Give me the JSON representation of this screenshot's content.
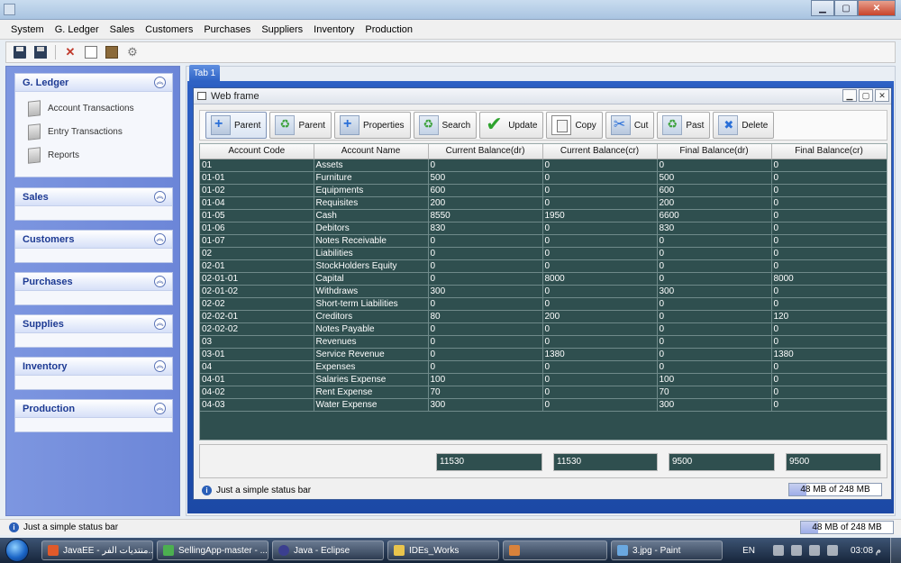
{
  "menu": [
    "System",
    "G. Ledger",
    "Sales",
    "Customers",
    "Purchases",
    "Suppliers",
    "Inventory",
    "Production"
  ],
  "sidebar": {
    "groups": [
      {
        "title": "G. Ledger",
        "items": [
          "Account Transactions",
          "Entry Transactions",
          "Reports"
        ]
      },
      {
        "title": "Sales",
        "items": []
      },
      {
        "title": "Customers",
        "items": []
      },
      {
        "title": "Purchases",
        "items": []
      },
      {
        "title": "Supplies",
        "items": []
      },
      {
        "title": "Inventory",
        "items": []
      },
      {
        "title": "Production",
        "items": []
      }
    ]
  },
  "tab": {
    "label": "Tab 1"
  },
  "frame": {
    "title": "Web frame"
  },
  "actions": [
    "Parent",
    "Parent",
    "Properties",
    "Search",
    "Update",
    "Copy",
    "Cut",
    "Past",
    "Delete"
  ],
  "table": {
    "headers": [
      "Account Code",
      "Account Name",
      "Current Balance(dr)",
      "Current Balance(cr)",
      "Final Balance(dr)",
      "Final Balance(cr)"
    ],
    "rows": [
      [
        "01",
        "Assets",
        "0",
        "0",
        "0",
        "0"
      ],
      [
        "01-01",
        "Furniture",
        "500",
        "0",
        "500",
        "0"
      ],
      [
        "01-02",
        "Equipments",
        "600",
        "0",
        "600",
        "0"
      ],
      [
        "01-04",
        "Requisites",
        "200",
        "0",
        "200",
        "0"
      ],
      [
        "01-05",
        "Cash",
        "8550",
        "1950",
        "6600",
        "0"
      ],
      [
        "01-06",
        "Debitors",
        "830",
        "0",
        "830",
        "0"
      ],
      [
        "01-07",
        "Notes Receivable",
        "0",
        "0",
        "0",
        "0"
      ],
      [
        "02",
        "Liabilities",
        "0",
        "0",
        "0",
        "0"
      ],
      [
        "02-01",
        "StockHolders Equity",
        "0",
        "0",
        "0",
        "0"
      ],
      [
        "02-01-01",
        "Capital",
        "0",
        "8000",
        "0",
        "8000"
      ],
      [
        "02-01-02",
        "Withdraws",
        "300",
        "0",
        "300",
        "0"
      ],
      [
        "02-02",
        "Short-term Liabilities",
        "0",
        "0",
        "0",
        "0"
      ],
      [
        "02-02-01",
        "Creditors",
        "80",
        "200",
        "0",
        "120"
      ],
      [
        "02-02-02",
        "Notes Payable",
        "0",
        "0",
        "0",
        "0"
      ],
      [
        "03",
        "Revenues",
        "0",
        "0",
        "0",
        "0"
      ],
      [
        "03-01",
        "Service Revenue",
        "0",
        "1380",
        "0",
        "1380"
      ],
      [
        "04",
        "Expenses",
        "0",
        "0",
        "0",
        "0"
      ],
      [
        "04-01",
        "Salaries Expense",
        "100",
        "0",
        "100",
        "0"
      ],
      [
        "04-02",
        "Rent Expense",
        "70",
        "0",
        "70",
        "0"
      ],
      [
        "04-03",
        "Water Expense",
        "300",
        "0",
        "300",
        "0"
      ]
    ]
  },
  "totals": [
    "11530",
    "11530",
    "9500",
    "9500"
  ],
  "status": {
    "text": "Just a simple status bar",
    "memory": "48 MB of 248 MB",
    "memory_used_fraction": 0.19
  },
  "taskbar": {
    "tasks": [
      "JavaEE - منتديات الفر...",
      "SellingApp-master - ...",
      "Java - Eclipse",
      "IDEs_Works",
      "",
      "3.jpg - Paint"
    ],
    "lang": "EN",
    "clock": "03:08 م"
  }
}
